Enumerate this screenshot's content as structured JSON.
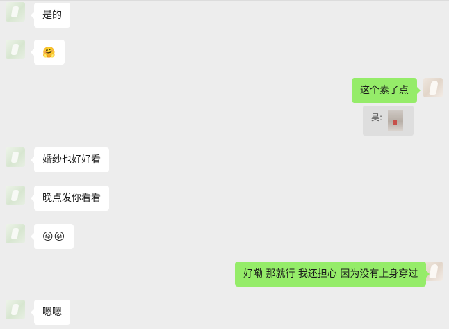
{
  "messages": [
    {
      "side": "left",
      "text": "是的"
    },
    {
      "side": "left",
      "text": "🤗"
    },
    {
      "side": "right",
      "text": "这个素了点",
      "quote": {
        "label": "昊:",
        "kind": "image"
      }
    },
    {
      "side": "left",
      "text": "婚纱也好好看"
    },
    {
      "side": "left",
      "text": "晚点发你看看"
    },
    {
      "side": "left",
      "text": "😝😝"
    },
    {
      "side": "right",
      "text": "好嘞 那就行 我还担心 因为没有上身穿过"
    },
    {
      "side": "left",
      "text": "嗯嗯"
    }
  ],
  "colors": {
    "background": "#ededed",
    "incoming_bubble": "#ffffff",
    "outgoing_bubble": "#95ec69"
  }
}
